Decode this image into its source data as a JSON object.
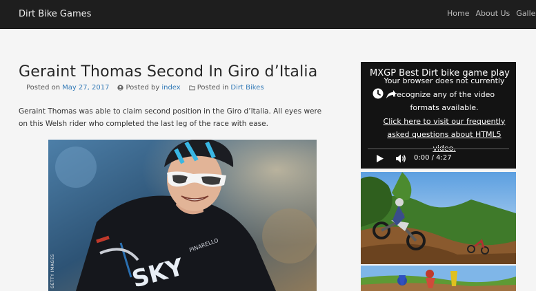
{
  "site": {
    "brand": "Dirt Bike Games"
  },
  "nav": {
    "items": [
      "Home",
      "About Us",
      "Gallery"
    ]
  },
  "post": {
    "title": "Geraint Thomas Second In Giro d’Italia",
    "meta": {
      "posted_on_label": "Posted on",
      "date": "May 27, 2017",
      "posted_by_label": "Posted by",
      "author": "index",
      "posted_in_label": "Posted in",
      "category": "Dirt Bikes"
    },
    "excerpt": "Geraint Thomas was able to claim second position in the Giro d’Italia. All eyes were on this Welsh rider who completed the last leg of the race with ease.",
    "image_credit": "GETTY IMAGES"
  },
  "video_widget": {
    "title": "MXGP Best Dirt bike game play",
    "message_line1": "Your browser does not currently recognize any of the video formats available.",
    "message_link": "Click here to visit our frequently asked questions about HTML5 video.",
    "time": "0:00 / 4:27"
  },
  "icons": {
    "calendar": "clock-icon",
    "author": "user-icon",
    "category": "folder-icon",
    "video_clock": "clock-icon",
    "video_share": "share-icon",
    "play": "play-icon",
    "volume": "volume-icon"
  }
}
